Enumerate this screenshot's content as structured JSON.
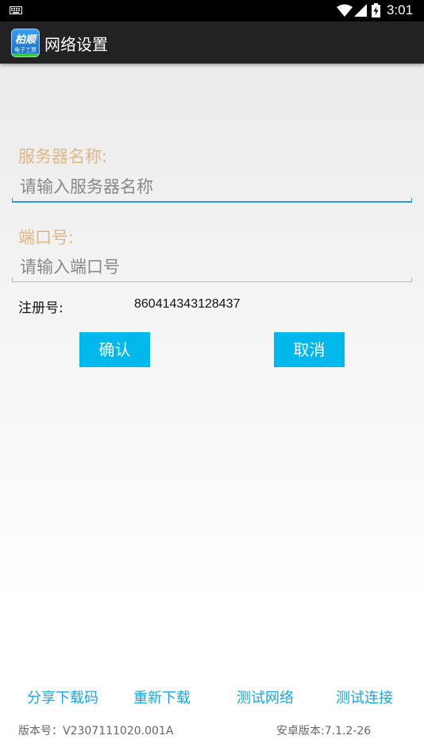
{
  "status_bar": {
    "time": "3:01",
    "icons": [
      "keyboard-icon",
      "wifi-icon",
      "signal-icon",
      "battery-charging-icon"
    ]
  },
  "app_bar": {
    "logo_top": "柏顺",
    "logo_bottom": "电子工票",
    "title": "网络设置"
  },
  "form": {
    "server_label": "服务器名称:",
    "server_placeholder": "请输入服务器名称",
    "server_value": "",
    "port_label": "端口号:",
    "port_placeholder": "请输入端口号",
    "port_value": "",
    "reg_label": "注册号:",
    "reg_value": "860414343128437"
  },
  "buttons": {
    "confirm": "确认",
    "cancel": "取消"
  },
  "bottom_links": {
    "share": "分享下载码",
    "redownload": "重新下载",
    "test_network": "测试网络",
    "test_connection": "测试连接"
  },
  "footer": {
    "version": "版本号：V2307111020.001A",
    "android_version": "安卓版本:7.1.2-26"
  },
  "colors": {
    "accent": "#00b8ec",
    "label": "#e0b784",
    "link": "#17a6e3",
    "focus_line": "#2a9bd6"
  }
}
